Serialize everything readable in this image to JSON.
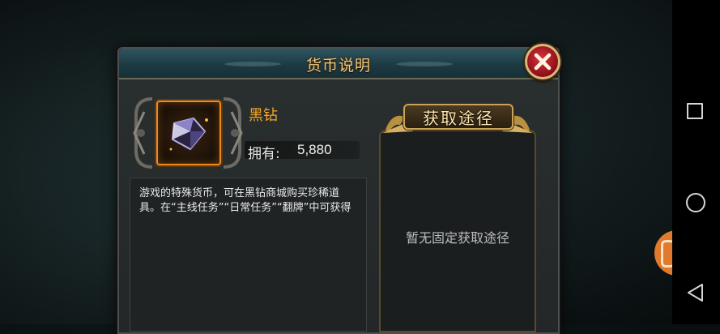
{
  "dialog": {
    "title": "货币说明"
  },
  "item": {
    "name": "黑钻",
    "own_label": "拥有:",
    "own_value": "5,880",
    "description": "游戏的特殊货币，可在黑钻商城购买珍稀道具。在“主线任务”“日常任务”“翻牌”中可获得"
  },
  "source": {
    "title": "获取途径",
    "empty_text": "暂无固定获取途径"
  },
  "colors": {
    "title": "#f1c77a",
    "item_name": "#f5a623",
    "frame_orange": "#f08a1c",
    "nav_bg": "#000000"
  },
  "icons": {
    "close": "close-x-icon",
    "item": "black-diamond-icon",
    "nav_recent": "square-icon",
    "nav_home": "circle-icon",
    "nav_back": "triangle-back-icon"
  }
}
